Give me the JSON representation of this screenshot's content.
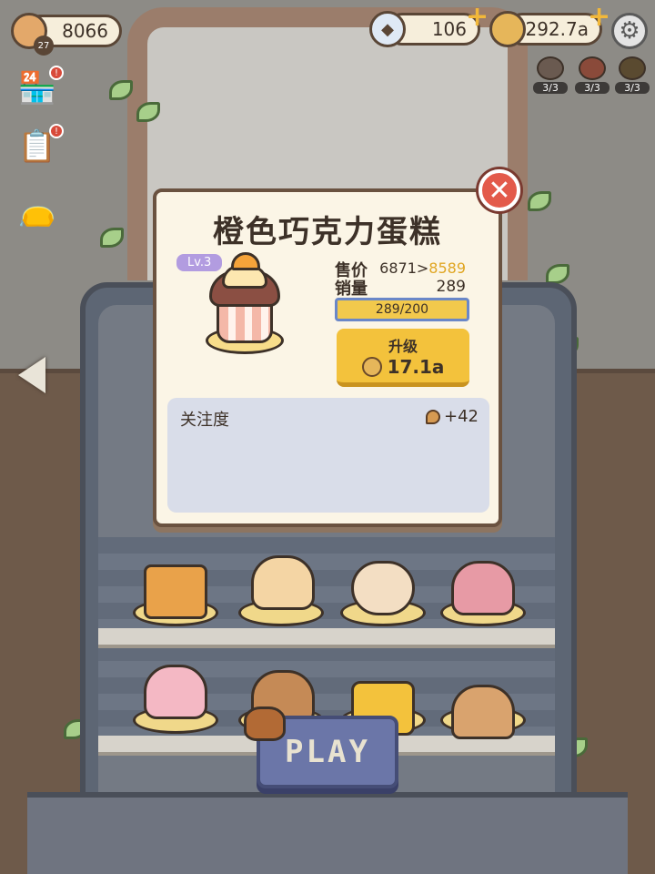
{
  "hud": {
    "level": "27",
    "beans": "8066",
    "gems": "106",
    "coins": "292.7a"
  },
  "buffs": [
    {
      "label": "3/3"
    },
    {
      "label": "3/3"
    },
    {
      "label": "3/3"
    }
  ],
  "popup": {
    "title": "橙色巧克力蛋糕",
    "level": "Lv.3",
    "price_label": "售价",
    "price_current": "6871",
    "price_arrow": ">",
    "price_next": "8589",
    "sales_label": "销量",
    "sales_value": "289",
    "progress_text": "289/200",
    "upgrade_label": "升级",
    "upgrade_cost": "17.1a",
    "attention_label": "关注度",
    "attention_value": "+42"
  },
  "play_label": "PLAY",
  "colors": {
    "accent": "#f3c23c",
    "close": "#e35a4b",
    "level_badge": "#b29ce0",
    "play": "#6b76a8"
  }
}
